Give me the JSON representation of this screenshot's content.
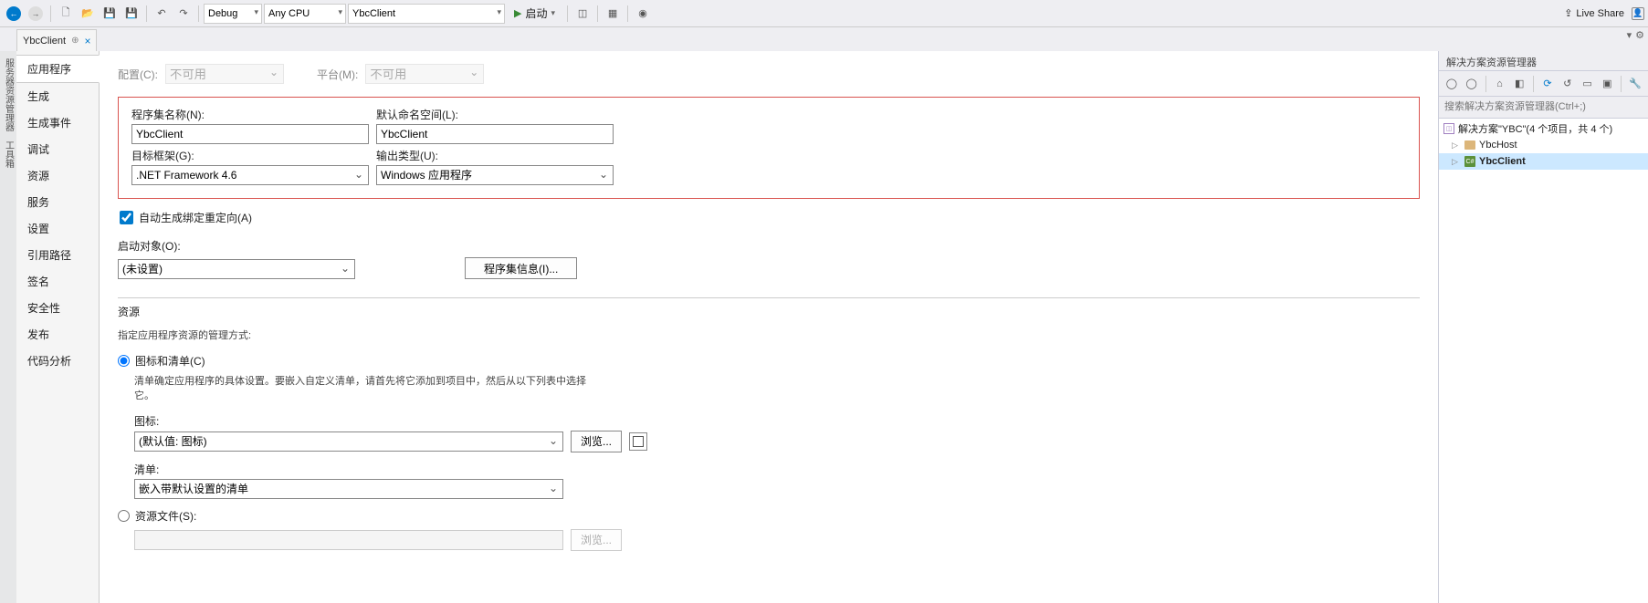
{
  "toolbar": {
    "configs": [
      "Debug"
    ],
    "platforms": [
      "Any CPU"
    ],
    "projects": [
      "YbcClient"
    ],
    "start_label": "启动",
    "live_share": "Live Share"
  },
  "tab": {
    "name": "YbcClient"
  },
  "sideNav": {
    "items": [
      "应用程序",
      "生成",
      "生成事件",
      "调试",
      "资源",
      "服务",
      "设置",
      "引用路径",
      "签名",
      "安全性",
      "发布",
      "代码分析"
    ]
  },
  "cfgBar": {
    "config_label": "配置(C):",
    "config_value": "不可用",
    "platform_label": "平台(M):",
    "platform_value": "不可用"
  },
  "assembly": {
    "name_label": "程序集名称(N):",
    "name_value": "YbcClient",
    "ns_label": "默认命名空间(L):",
    "ns_value": "YbcClient",
    "fw_label": "目标框架(G):",
    "fw_value": ".NET Framework 4.6",
    "out_label": "输出类型(U):",
    "out_value": "Windows 应用程序"
  },
  "autoBinding": "自动生成绑定重定向(A)",
  "startup": {
    "label": "启动对象(O):",
    "value": "(未设置)",
    "asmInfo": "程序集信息(I)..."
  },
  "resources": {
    "title": "资源",
    "help": "指定应用程序资源的管理方式:",
    "radio_icon_label": "图标和清单(C)",
    "icon_help": "清单确定应用程序的具体设置。要嵌入自定义清单，请首先将它添加到项目中，然后从以下列表中选择它。",
    "icon_label": "图标:",
    "icon_value": "(默认值: 图标)",
    "browse": "浏览...",
    "manifest_label": "清单:",
    "manifest_value": "嵌入带默认设置的清单",
    "radio_res_label": "资源文件(S):",
    "browse2": "浏览..."
  },
  "solExp": {
    "title": "解决方案资源管理器",
    "search_ph": "搜索解决方案资源管理器(Ctrl+;)",
    "solution": "解决方案\"YBC\"(4 个项目，共 4 个)",
    "nodes": [
      "YbcHost",
      "YbcClient"
    ]
  }
}
